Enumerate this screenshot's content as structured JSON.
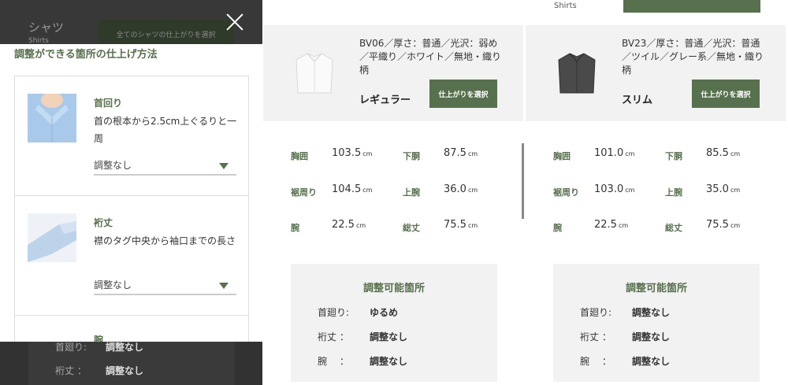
{
  "background": {
    "category_title": "シャツ",
    "category_sub": "Shirts",
    "select_all_label": "全てのシャツの仕上がりを選択",
    "top_sub": "Shirts"
  },
  "products": [
    {
      "desc": "BV06／厚さ：普通／光沢：弱め／平織り／ホワイト／無地・織り柄",
      "fit": "レギュラー",
      "select_label": "仕上がりを選択",
      "measurements": {
        "chest": "103.5",
        "hem": "87.5",
        "hem_round": "104.5",
        "upper_arm": "36.0",
        "sleeve": "22.5",
        "length": "75.5"
      },
      "adjustments": {
        "neck": "ゆるめ",
        "yuki": "調整なし",
        "arm": "調整なし"
      }
    },
    {
      "desc": "BV23／厚さ：普通／光沢：普通／ツイル／グレー系／無地・織り柄",
      "fit": "スリム",
      "select_label": "仕上がりを選択",
      "measurements": {
        "chest": "101.0",
        "hem": "85.5",
        "hem_round": "103.0",
        "upper_arm": "35.0",
        "sleeve": "22.5",
        "length": "75.5"
      },
      "adjustments": {
        "neck": "調整なし",
        "yuki": "調整なし",
        "arm": "調整なし"
      }
    }
  ],
  "labels": {
    "chest": "胸囲",
    "hem": "下胴",
    "hem_round": "裾周り",
    "upper_arm": "上腕",
    "sleeve": "腕",
    "length": "総丈",
    "unit": "cm",
    "adj_title": "調整可能箇所",
    "adj_neck": "首廻り:",
    "adj_yuki": "裄丈 ：",
    "adj_arm": "腕 　："
  },
  "modal": {
    "title": "調整ができる箇所の仕上げ方法",
    "items": [
      {
        "name": "首回り",
        "note": "首の根本から2.5cm上ぐるりと一周",
        "value": "調整なし"
      },
      {
        "name": "裄丈",
        "note": "襟のタグ中央から袖口までの長さ",
        "value": "調整なし"
      },
      {
        "name": "腕"
      }
    ]
  },
  "bottom": {
    "neck_label": "首廻り:",
    "neck_value": "調整なし",
    "yuki_label": "裄丈 ：",
    "yuki_value": "調整なし"
  },
  "colors": {
    "accent": "#57704d"
  }
}
